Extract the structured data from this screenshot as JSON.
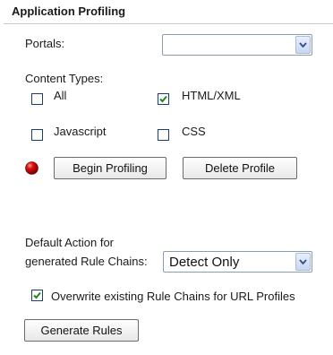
{
  "section": {
    "title": "Application Profiling"
  },
  "portals": {
    "label": "Portals:",
    "value": ""
  },
  "content_types": {
    "label": "Content Types:",
    "items": [
      {
        "label": "All",
        "checked": false
      },
      {
        "label": "HTML/XML",
        "checked": true
      },
      {
        "label": "Javascript",
        "checked": false
      },
      {
        "label": "CSS",
        "checked": false
      }
    ]
  },
  "profiling": {
    "status_color": "#d10000",
    "begin_label": "Begin Profiling",
    "delete_label": "Delete Profile"
  },
  "default_action": {
    "label_line1": "Default Action for",
    "label_line2": "generated Rule Chains:",
    "value": "Detect Only"
  },
  "overwrite": {
    "label": "Overwrite existing Rule Chains for URL Profiles",
    "checked": true
  },
  "generate": {
    "label": "Generate Rules"
  }
}
